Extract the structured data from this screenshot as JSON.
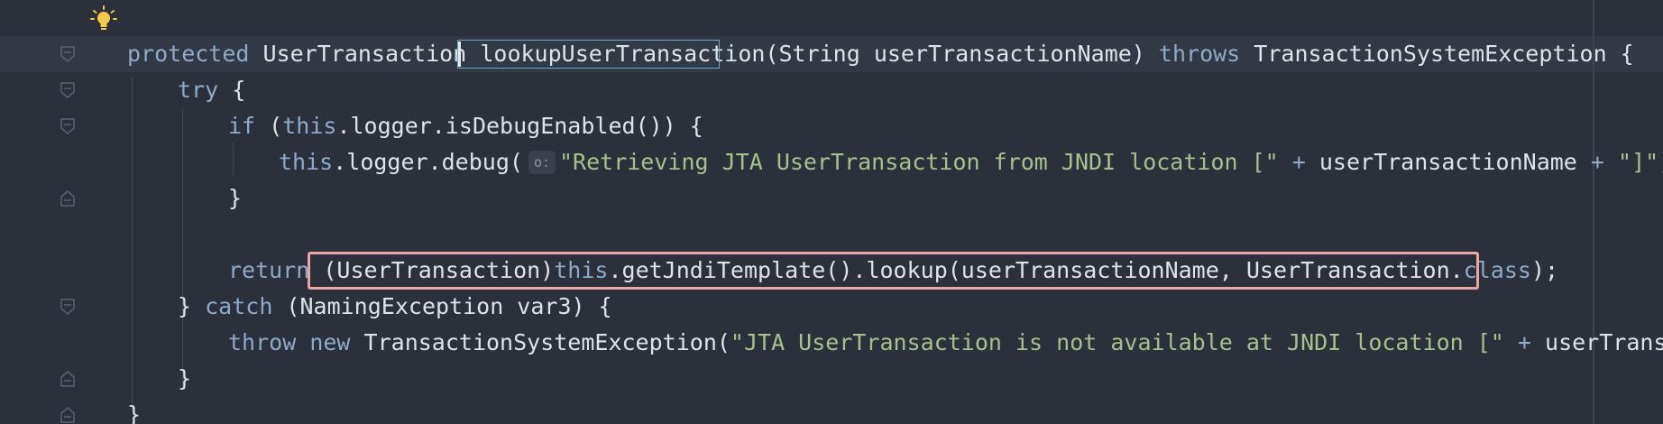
{
  "colors": {
    "background": "#2b303b",
    "keyword": "#8fa9c9",
    "string": "#a6c08f",
    "text": "#dfe2e7",
    "selection_box": "#e9a6a6",
    "match_box": "#6aa9c9"
  },
  "icons": {
    "bulb": "lightbulb-icon",
    "fold": "fold-marker-icon"
  },
  "code": {
    "l1": {
      "kw_protected": "protected",
      "type": " UserTransaction ",
      "method": "lookupUserTransaction",
      "params": "(String userTransactionName) ",
      "kw_throws": "throws",
      "exc": " TransactionSystemException {"
    },
    "l2": {
      "kw_try": "try",
      "rest": " {"
    },
    "l3": {
      "kw_if": "if",
      "p1": " (",
      "kw_this": "this",
      "rest": ".logger.isDebugEnabled()) {"
    },
    "l4": {
      "kw_this": "this",
      "call": ".logger.debug(",
      "hint": "o:",
      "str1": "\"Retrieving JTA UserTransaction from JNDI location [\"",
      "plus1": " + ",
      "var": "userTransactionName",
      "plus2": " + ",
      "str2": "\"]\"",
      "end": ");"
    },
    "l5": {
      "brace": "}"
    },
    "l7": {
      "kw_return": "return",
      "cast": " (UserTransaction)",
      "kw_this": "this",
      "call": ".getJndiTemplate().lookup(userTransactionName, UserTransaction.",
      "kw_class": "class",
      "end": ");"
    },
    "l8": {
      "brace": "} ",
      "kw_catch": "catch",
      "rest": " (NamingException var3) {"
    },
    "l9": {
      "kw_throw": "throw",
      "sp": " ",
      "kw_new": "new",
      "call": " TransactionSystemException(",
      "str": "\"JTA UserTransaction is not available at JNDI location [\"",
      "plus": " + ",
      "var": "userTransactionNa"
    },
    "l10": {
      "brace": "}"
    },
    "l11": {
      "brace": "}"
    }
  }
}
